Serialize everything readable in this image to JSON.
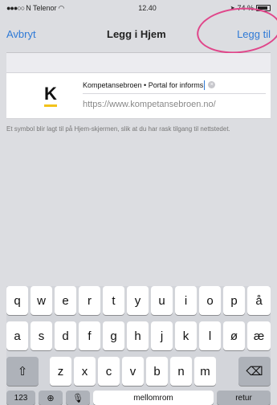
{
  "status_bar": {
    "carrier": "N Telenor",
    "time": "12.40",
    "battery": "74 %"
  },
  "nav": {
    "cancel_label": "Avbryt",
    "title": "Legg i Hjem",
    "add_label": "Legg til"
  },
  "form": {
    "icon_letter": "K",
    "name_value": "Kompetansebroen • Portal for informs",
    "url_value": "https://www.kompetansebroen.no/"
  },
  "info_text": "Et symbol blir lagt til på Hjem-skjermen, slik at du har rask tilgang til nettstedet.",
  "keyboard": {
    "row1": [
      "q",
      "w",
      "e",
      "r",
      "t",
      "y",
      "u",
      "i",
      "o",
      "p",
      "å"
    ],
    "row2": [
      "a",
      "s",
      "d",
      "f",
      "g",
      "h",
      "j",
      "k",
      "l",
      "ø",
      "æ"
    ],
    "row3": [
      "z",
      "x",
      "c",
      "v",
      "b",
      "n",
      "m"
    ],
    "numbers_label": "123",
    "space_label": "mellomrom",
    "return_label": "retur"
  },
  "colors": {
    "accent": "#2f7ad6",
    "highlight": "#e0468a",
    "brand_bar": "#f2c21a"
  }
}
